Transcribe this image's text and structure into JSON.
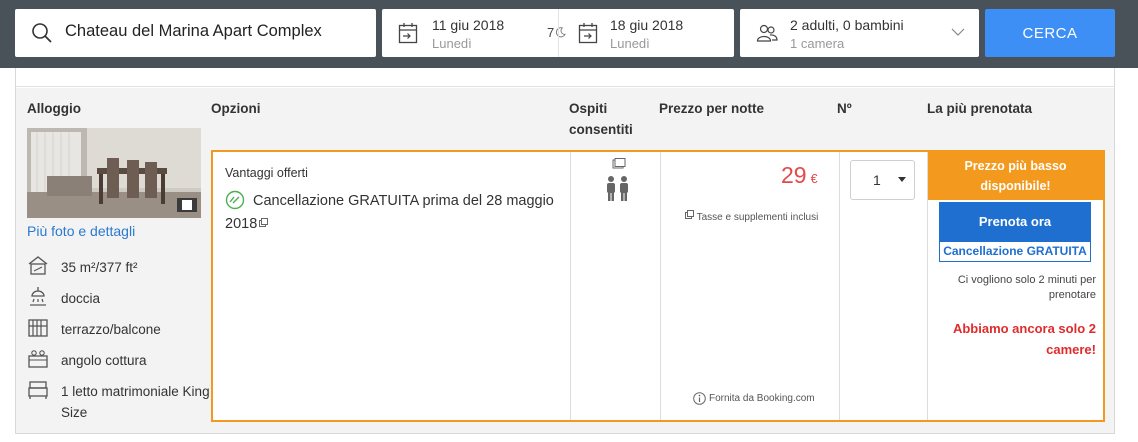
{
  "search": {
    "destination": "Chateau del Marina Apart Complex",
    "checkin": {
      "date": "11 giu 2018",
      "weekday": "Lunedì"
    },
    "nights": "7",
    "checkout": {
      "date": "18 giu 2018",
      "weekday": "Lunedì"
    },
    "guests": {
      "summary": "2 adulti, 0 bambini",
      "rooms": "1 camera"
    },
    "button": "CERCA"
  },
  "table": {
    "headers": {
      "accommodation": "Alloggio",
      "options": "Opzioni",
      "guests": "Ospiti consentiti",
      "price": "Prezzo per notte",
      "number": "Nº",
      "most_booked": "La più prenotata"
    }
  },
  "room": {
    "more_link": "Più foto e dettagli",
    "amenities": [
      {
        "icon": "area-icon",
        "label": "35 m²/377 ft²"
      },
      {
        "icon": "shower-icon",
        "label": "doccia"
      },
      {
        "icon": "balcony-icon",
        "label": "terrazzo/balcone"
      },
      {
        "icon": "kitchenette-icon",
        "label": "angolo cottura"
      },
      {
        "icon": "bed-icon",
        "label": "1 letto matrimoniale King Size"
      }
    ]
  },
  "offer": {
    "perks_title": "Vantaggi offerti",
    "perk": "Cancellazione GRATUITA prima del 28 maggio 2018",
    "price": "29",
    "currency": "€",
    "tax_note": "Tasse e supplementi inclusi",
    "provider": "Fornita da Booking.com",
    "quantity": "1",
    "best_price": "Prezzo più basso disponibile!",
    "book_button": "Prenota ora",
    "free_cancel": "Cancellazione GRATUITA",
    "two_minutes": "Ci vogliono solo 2 minuti per prenotare",
    "rooms_left": "Abbiamo ancora solo 2 camere!"
  },
  "colors": {
    "accent_blue": "#3d8ef5",
    "book_blue": "#1e6fd0",
    "orange": "#f39a1e",
    "price_red": "#e34a4a",
    "link": "#2a79d0"
  }
}
